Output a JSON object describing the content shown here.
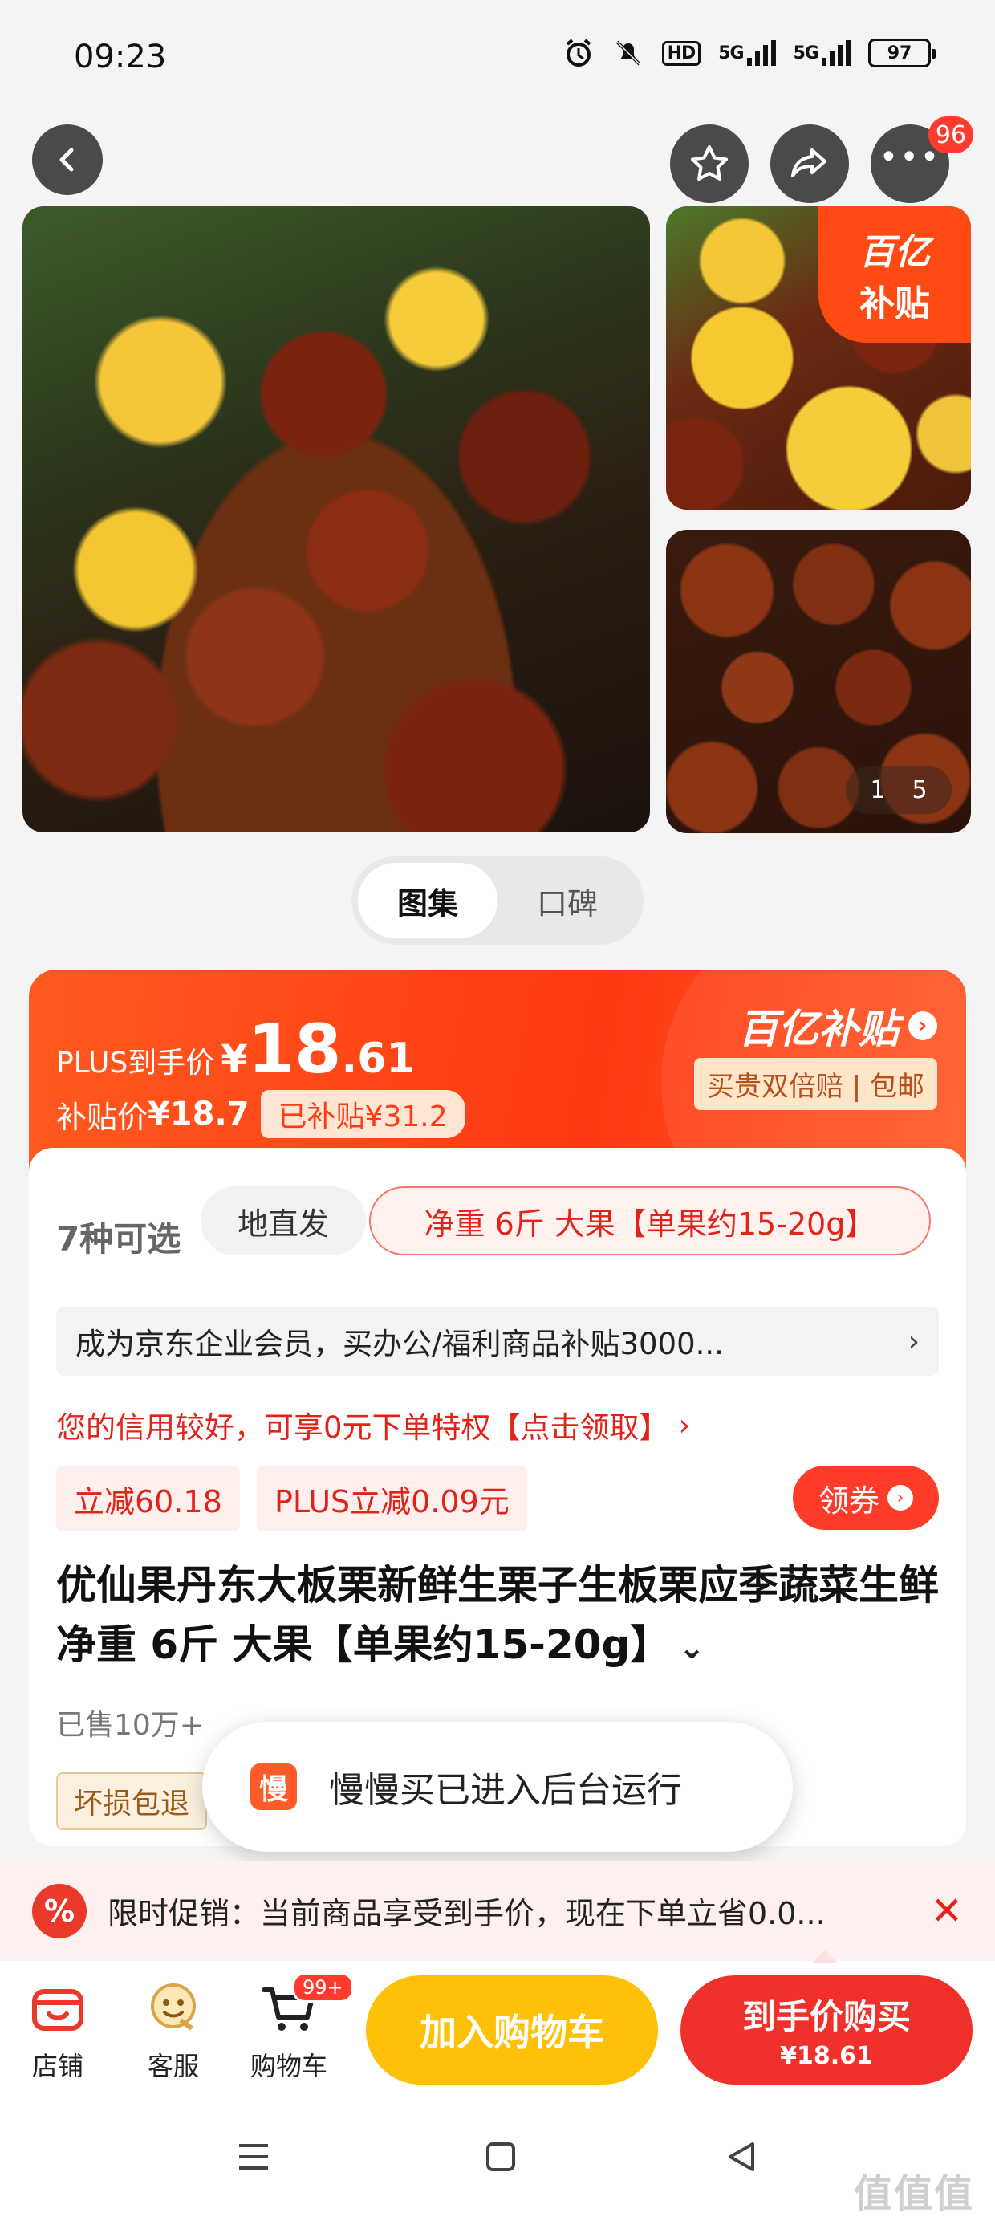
{
  "status_bar": {
    "time": "09:23",
    "hd_label": "HD",
    "sim1": "5G",
    "sim2": "5G",
    "battery": "97"
  },
  "header": {
    "cart_badge_count": "96"
  },
  "gallery": {
    "subsidy_tag_line1": "百亿",
    "subsidy_tag_line2": "补贴",
    "counter_current": "1",
    "counter_total": "5",
    "tabs": [
      {
        "label": "图集",
        "active": true
      },
      {
        "label": "口碑",
        "active": false
      }
    ]
  },
  "price": {
    "plus_label": "PLUS到手价",
    "plus_yen": "¥",
    "plus_int": "18",
    "plus_dec": ".61",
    "subsidy_label": "补贴价",
    "subsidy_value": "¥18.7",
    "subsidized_pill": "已补贴¥31.2",
    "brand": "百亿补贴",
    "brand_sub": "买贵双倍赔 | 包邮"
  },
  "variants": {
    "count_label": "7种可选",
    "option1": "地直发",
    "option2": "净重 6斤 大果【单果约15-20g】"
  },
  "enterprise_bar": "成为京东企业会员，买办公/福利商品补贴3000...",
  "credit_line": "您的信用较好，可享0元下单特权【点击领取】",
  "promos": {
    "tag1": "立减60.18",
    "tag2": "PLUS立减0.09元",
    "coupon": "领券"
  },
  "product": {
    "title": "优仙果丹东大板栗新鲜生栗子生板栗应季蔬菜生鲜 净重 6斤 大果【单果约15-20g】",
    "sold": "已售10万+",
    "damage_tag": "坏损包退"
  },
  "toast": {
    "icon_char": "慢",
    "text": "慢慢买已进入后台运行"
  },
  "promo_strip": {
    "icon_char": "%",
    "text": "限时促销：当前商品享受到手价，现在下单立省0.0..."
  },
  "bottom_bar": {
    "shop": "店铺",
    "service": "客服",
    "cart": "购物车",
    "cart_badge": "99+",
    "add_to_cart": "加入购物车",
    "buy_label": "到手价购买",
    "buy_price": "¥18.61"
  },
  "watermark": "值值值",
  "colors": {
    "brand_red": "#f0302a",
    "subsidy_orange": "#ff4a14",
    "cart_yellow": "#ffc107"
  }
}
